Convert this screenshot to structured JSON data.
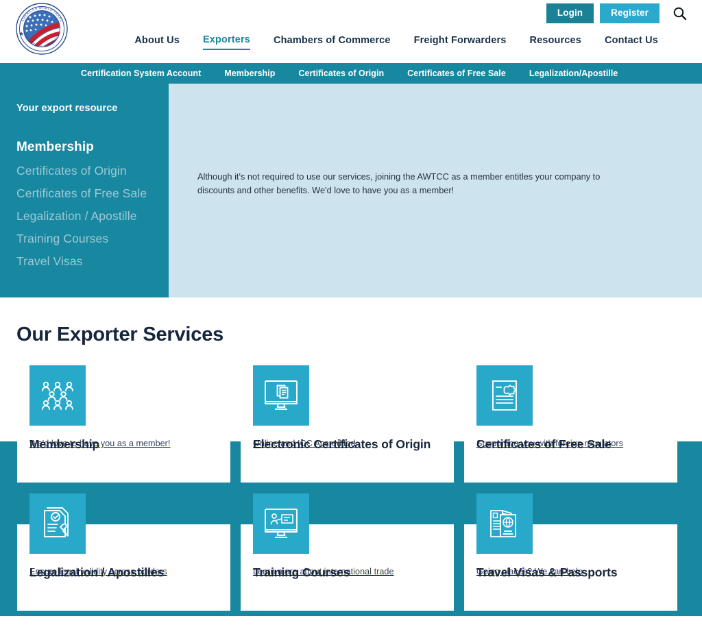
{
  "brand": {
    "logo_alt": "American World Trade Chamber of Commerce seal",
    "logo_text_outer_top": "AMERICAN WORLD TRADE",
    "logo_text_outer_bottom": "CHAMBER OF COMMERCE"
  },
  "colors": {
    "teal": "#1887a0",
    "cyan": "#29a9cc",
    "login_teal": "#1b8196",
    "panel_light": "#cde3ed",
    "navy": "#17263c",
    "side_link": "#9dc9d6"
  },
  "header": {
    "login_label": "Login",
    "register_label": "Register",
    "search_icon": "search-icon",
    "nav": [
      {
        "label": "About Us",
        "active": false
      },
      {
        "label": "Exporters",
        "active": true
      },
      {
        "label": "Chambers of Commerce",
        "active": false
      },
      {
        "label": "Freight Forwarders",
        "active": false
      },
      {
        "label": "Resources",
        "active": false
      },
      {
        "label": "Contact Us",
        "active": false
      }
    ]
  },
  "subnav": {
    "items": [
      {
        "label": "Certification System Account"
      },
      {
        "label": "Membership"
      },
      {
        "label": "Certificates of Origin"
      },
      {
        "label": "Certificates of Free Sale"
      },
      {
        "label": "Legalization/Apostille"
      }
    ]
  },
  "hero": {
    "eyebrow": "Your export resource",
    "links": [
      {
        "label": "Membership",
        "active": true
      },
      {
        "label": "Certificates of Origin",
        "active": false
      },
      {
        "label": "Certificates of Free Sale",
        "active": false
      },
      {
        "label": "Legalization / Apostille",
        "active": false
      },
      {
        "label": "Training Courses",
        "active": false
      },
      {
        "label": "Travel Visas",
        "active": false
      }
    ],
    "body": "Although it's not required to use our services, joining the AWTCC as a member entitles your company to discounts and other benefits. We'd love to have you as a member!"
  },
  "services": {
    "heading": "Our Exporter Services",
    "cards": [
      {
        "title": "Membership",
        "desc": "We'd love to have you as a member!",
        "icon": "people-group-icon"
      },
      {
        "title": "Electronic Certificates of Origin",
        "desc": "Online and ICC Accredited",
        "icon": "monitor-documents-icon"
      },
      {
        "title": "Certificates of Free Sale",
        "desc": "Supporting you with foreign regulators",
        "icon": "certificate-seal-icon"
      },
      {
        "title": "Legalization / Apostilles",
        "desc": "Ensure legal validity across borders",
        "icon": "stamped-document-icon"
      },
      {
        "title": "Training Courses",
        "desc": "Learn more about international trade",
        "icon": "monitor-presenter-icon"
      },
      {
        "title": "Travel Visas & Passports",
        "desc": "Going places? We can help",
        "icon": "passport-globe-icon"
      }
    ]
  }
}
